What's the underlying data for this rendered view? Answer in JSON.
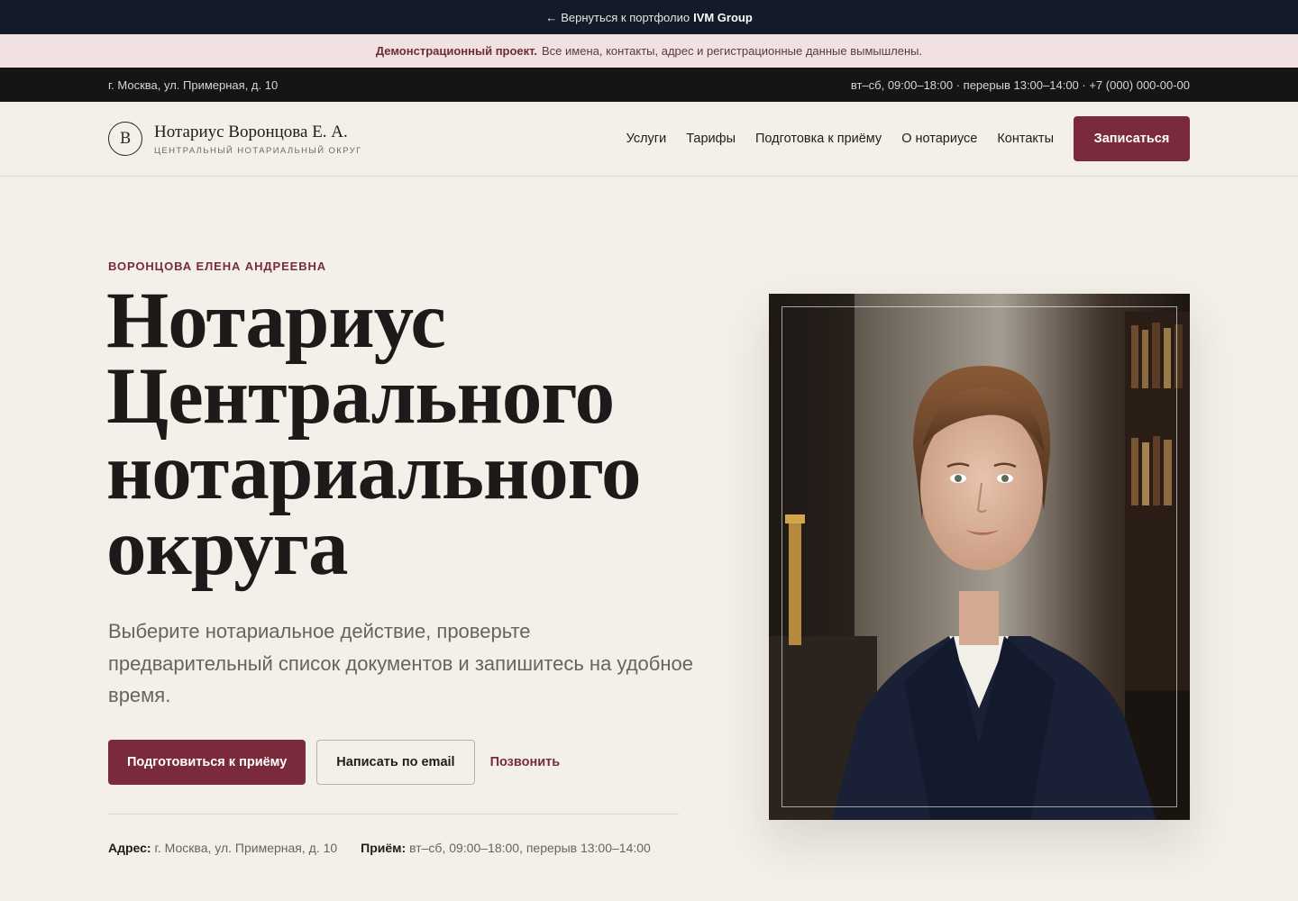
{
  "topbar": {
    "arrow": "←",
    "back_text": "Вернуться к портфолио",
    "brand": "IVM Group"
  },
  "demo_banner": {
    "strong": "Демонстрационный проект.",
    "text": "Все имена, контакты, адрес и регистрационные данные вымышлены."
  },
  "info_bar": {
    "address": "г. Москва, ул. Примерная, д. 10",
    "schedule": "вт–сб, 09:00–18:00 · перерыв 13:00–14:00 · +7 (000) 000-00-00"
  },
  "header": {
    "logo_letter": "В",
    "logo_name": "Нотариус Воронцова Е. А.",
    "logo_sub": "ЦЕНТРАЛЬНЫЙ НОТАРИАЛЬНЫЙ ОКРУГ",
    "nav": [
      "Услуги",
      "Тарифы",
      "Подготовка к приёму",
      "О нотариусе",
      "Контакты"
    ],
    "cta": "Записаться"
  },
  "hero": {
    "eyebrow": "ВОРОНЦОВА ЕЛЕНА АНДРЕЕВНА",
    "title": "Нотариус Центрального нотариального округа",
    "lead": "Выберите нотариальное действие, проверьте предварительный список документов и запишитесь на удобное время.",
    "btn_primary": "Подготовиться к приёму",
    "btn_outline": "Написать по email",
    "btn_link": "Позвонить",
    "address_label": "Адрес:",
    "address_value": "г. Москва, ул. Примерная, д. 10",
    "hours_label": "Приём:",
    "hours_value": "вт–сб, 09:00–18:00, перерыв 13:00–14:00"
  },
  "colors": {
    "accent": "#7a2a3a",
    "topbar": "#131b2a",
    "infobar": "#151515",
    "background": "#f3f0e9"
  }
}
